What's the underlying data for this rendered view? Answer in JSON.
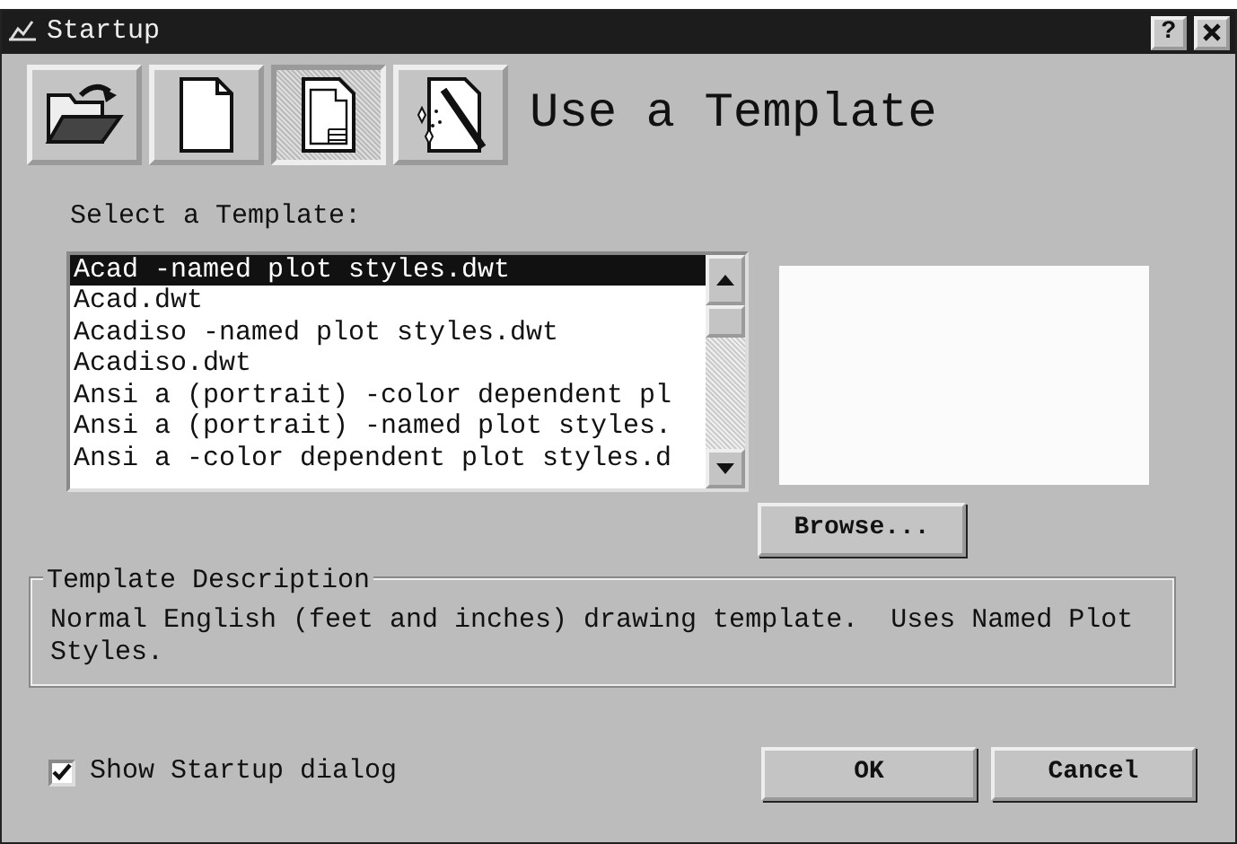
{
  "window": {
    "title": "Startup",
    "help_button": "?"
  },
  "modes": [
    {
      "kind": "open",
      "selected": false
    },
    {
      "kind": "scratch",
      "selected": false
    },
    {
      "kind": "template",
      "selected": true
    },
    {
      "kind": "wizard",
      "selected": false
    }
  ],
  "heading": "Use a Template",
  "list_label": "Select a Template:",
  "templates": [
    {
      "name": "Acad -named plot styles.dwt",
      "selected": true
    },
    {
      "name": "Acad.dwt",
      "selected": false
    },
    {
      "name": "Acadiso -named plot styles.dwt",
      "selected": false
    },
    {
      "name": "Acadiso.dwt",
      "selected": false
    },
    {
      "name": "Ansi a (portrait) -color dependent pl",
      "selected": false
    },
    {
      "name": "Ansi a (portrait) -named plot styles.",
      "selected": false
    },
    {
      "name": "Ansi a -color dependent plot styles.d",
      "selected": false
    }
  ],
  "browse_button": "Browse...",
  "description": {
    "label": "Template Description",
    "text": "Normal English (feet and inches) drawing template.  Uses Named Plot Styles."
  },
  "show_startup": {
    "label": "Show Startup dialog",
    "checked": true
  },
  "buttons": [
    "OK",
    "Cancel"
  ]
}
